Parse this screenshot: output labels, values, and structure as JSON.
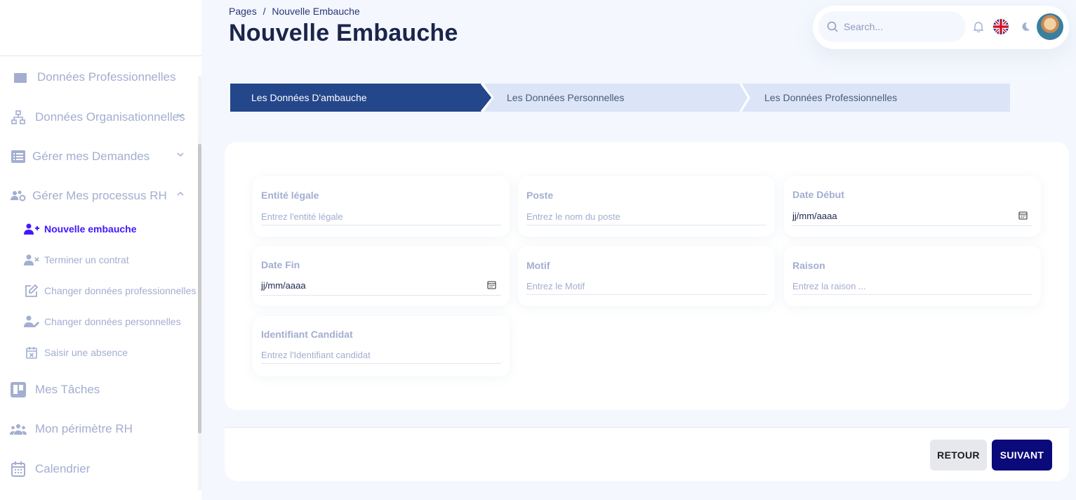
{
  "sidebar": {
    "items": [
      {
        "label": "Données Professionnelles",
        "icon": "briefcase-icon"
      },
      {
        "label": "Données Organisationnelles",
        "icon": "org-chart-icon",
        "expanded": false
      },
      {
        "label": "Gérer mes Demandes",
        "icon": "list-icon",
        "expanded": false
      },
      {
        "label": "Gérer Mes processus RH",
        "icon": "users-gear-icon",
        "expanded": true
      },
      {
        "label": "Mes Tâches",
        "icon": "kanban-icon"
      },
      {
        "label": "Mon périmètre RH",
        "icon": "group-icon"
      },
      {
        "label": "Calendrier",
        "icon": "calendar-icon"
      }
    ],
    "subitems": [
      {
        "label": "Nouvelle embauche",
        "icon": "user-plus-icon",
        "active": true
      },
      {
        "label": "Terminer un contrat",
        "icon": "user-x-icon"
      },
      {
        "label": "Changer données professionnelles",
        "icon": "edit-icon"
      },
      {
        "label": "Changer données personnelles",
        "icon": "user-edit-icon"
      },
      {
        "label": "Saisir une absence",
        "icon": "calendar-x-icon"
      }
    ]
  },
  "header": {
    "breadcrumb": [
      "Pages",
      "/",
      "Nouvelle Embauche"
    ],
    "title": "Nouvelle Embauche"
  },
  "topbar": {
    "search_placeholder": "Search...",
    "language": "EN"
  },
  "stepper": {
    "steps": [
      {
        "label": "Les Données D'ambauche",
        "active": true
      },
      {
        "label": "Les Données Personnelles",
        "active": false
      },
      {
        "label": "Les Données Professionnelles",
        "active": false
      }
    ]
  },
  "form": {
    "fields": [
      {
        "label": "Entité légale",
        "placeholder": "Entrez l'entité légale",
        "type": "text"
      },
      {
        "label": "Poste",
        "placeholder": "Entrez le nom du poste",
        "type": "text"
      },
      {
        "label": "Date Début",
        "value": "jj/mm/aaaa",
        "type": "date"
      },
      {
        "label": "Date Fin",
        "value": "jj/mm/aaaa",
        "type": "date"
      },
      {
        "label": "Motif",
        "placeholder": "Entrez le Motif",
        "type": "text"
      },
      {
        "label": "Raison",
        "placeholder": "Entrez la raison ...",
        "type": "text"
      },
      {
        "label": "Identifiant Candidat",
        "placeholder": "Entrez l'Identifiant candidat",
        "type": "text"
      }
    ]
  },
  "footer": {
    "back_label": "RETOUR",
    "next_label": "SUIVANT"
  },
  "colors": {
    "step_active": "#24468b",
    "step_inactive": "#dbe5f7",
    "next_button": "#0b0a7a",
    "active_nav": "#4318ff",
    "muted": "#a3aed0"
  }
}
